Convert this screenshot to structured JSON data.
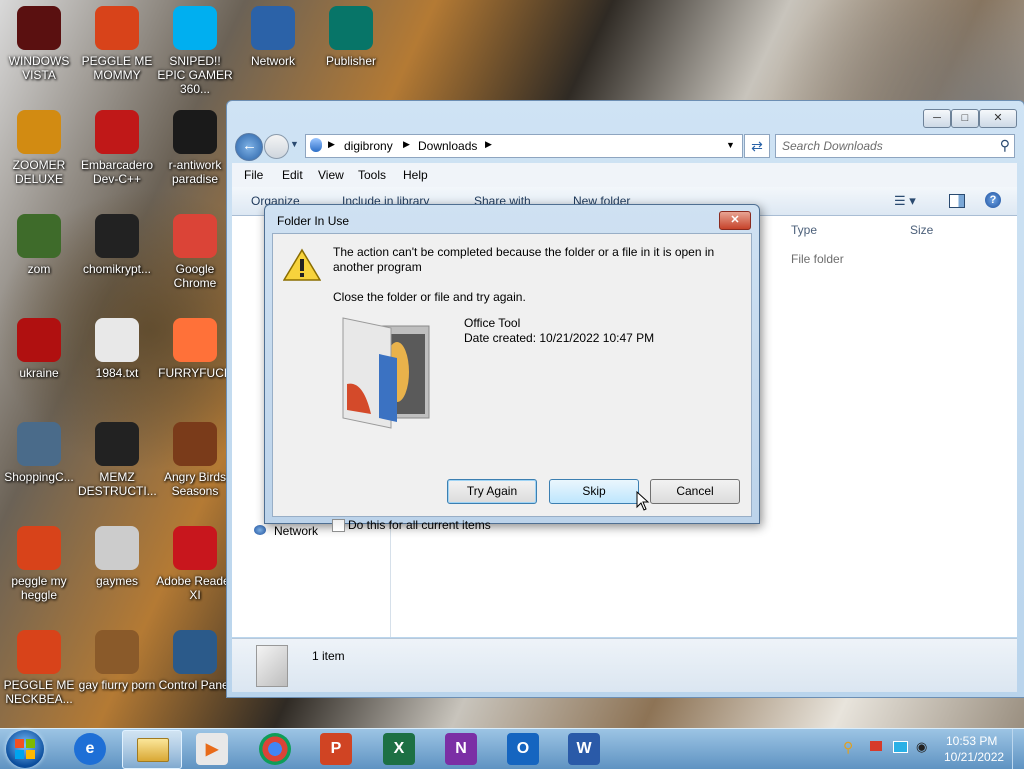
{
  "desktop": {
    "icons": [
      {
        "label": "WINDOWS VISTA",
        "color": "#5a1010"
      },
      {
        "label": "PEGGLE ME MOMMY",
        "color": "#d8431a"
      },
      {
        "label": "SNIPED!! EPIC GAMER 360...",
        "color": "#00aff0"
      },
      {
        "label": "Network",
        "color": "#2b62a8"
      },
      {
        "label": "Publisher",
        "color": "#077568"
      },
      {
        "label": "ZOOMER DELUXE",
        "color": "#d28b12"
      },
      {
        "label": "Embarcadero Dev-C++",
        "color": "#c01818"
      },
      {
        "label": "r-antiwork paradise",
        "color": "#1a1a1a"
      },
      {
        "label": "zom",
        "color": "#3e6b2a"
      },
      {
        "label": "chomikrypt...",
        "color": "#222222"
      },
      {
        "label": "Google Chrome",
        "color": "#db4437"
      },
      {
        "label": "ukraine",
        "color": "#b01010"
      },
      {
        "label": "1984.txt",
        "color": "#e8e8e8"
      },
      {
        "label": "FURRYFUCK",
        "color": "#ff7139"
      },
      {
        "label": "ShoppingC...",
        "color": "#4a6b8a"
      },
      {
        "label": "MEMZ DESTRUCTI...",
        "color": "#222222"
      },
      {
        "label": "Angry Birds Seasons",
        "color": "#7a3b1a"
      },
      {
        "label": "peggle my heggle",
        "color": "#d8431a"
      },
      {
        "label": "gaymes",
        "color": "#cccccc"
      },
      {
        "label": "Adobe Reader XI",
        "color": "#c8161d"
      },
      {
        "label": "PEGGLE ME NECKBEA...",
        "color": "#d8431a"
      },
      {
        "label": "gay fiurry porn",
        "color": "#8a5a2a"
      },
      {
        "label": "Control Panel",
        "color": "#2b5a8a"
      }
    ]
  },
  "explorer": {
    "breadcrumb": [
      "digibrony",
      "Downloads"
    ],
    "search_placeholder": "Search Downloads",
    "menu": [
      "File",
      "Edit",
      "View",
      "Tools",
      "Help"
    ],
    "toolbar": [
      "Organize",
      "Include in library",
      "Share with",
      "New folder"
    ],
    "columns": [
      "Type",
      "Size"
    ],
    "row": {
      "type": "File folder"
    },
    "nav_network": "Network",
    "status_count": "1 item"
  },
  "dialog": {
    "title": "Folder In Use",
    "message_line1": "The action can't be completed because the folder or a file in it is open in",
    "message_line2": "another program",
    "instruction": "Close the folder or file and try again.",
    "folder_name": "Office Tool",
    "date_created": "Date created: 10/21/2022 10:47 PM",
    "buttons": {
      "try_again": "Try Again",
      "skip": "Skip",
      "cancel": "Cancel"
    },
    "checkbox_label": "Do this for all current items"
  },
  "taskbar": {
    "time": "10:53 PM",
    "date": "10/21/2022"
  }
}
